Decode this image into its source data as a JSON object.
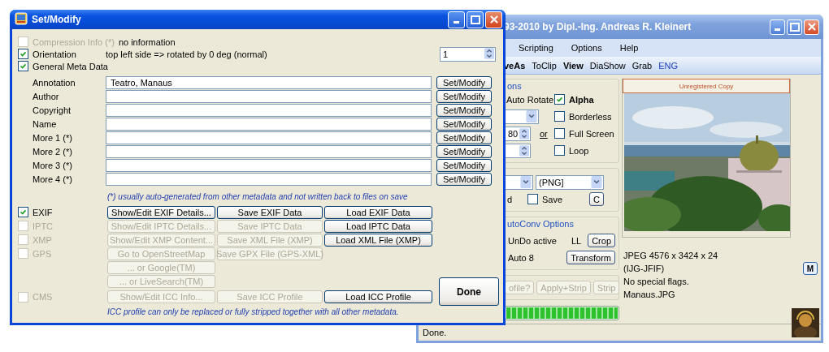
{
  "dialog": {
    "title": "Set/Modify",
    "info_rows": [
      {
        "label": "Compression Info (*)",
        "checked": false,
        "disabled": true,
        "value": "no information"
      },
      {
        "label": "Orientation",
        "checked": true,
        "disabled": false,
        "value": "top left side => rotated by 0 deg (normal)",
        "spinner": "1"
      },
      {
        "label": "General Meta Data",
        "checked": true,
        "disabled": false
      }
    ],
    "fields": [
      {
        "label": "Annotation",
        "value": "Teatro, Manaus",
        "button": "Set/Modify"
      },
      {
        "label": "Author",
        "button": "Set/Modify"
      },
      {
        "label": "Copyright",
        "button": "Set/Modify"
      },
      {
        "label": "Name",
        "button": "Set/Modify"
      },
      {
        "label": "More 1 (*)",
        "button": "Set/Modify"
      },
      {
        "label": "More 2 (*)",
        "button": "Set/Modify"
      },
      {
        "label": "More 3 (*)",
        "button": "Set/Modify"
      },
      {
        "label": "More 4 (*)",
        "button": "Set/Modify"
      }
    ],
    "note": "(*) usually auto-generated from other metadata and not written back to files on save",
    "sections": [
      {
        "label": "EXIF",
        "checked": true,
        "disabled": false,
        "buttons": [
          {
            "label": "Show/Edit EXIF Details...",
            "disabled": false
          },
          {
            "label": "Save EXIF Data",
            "disabled": false
          },
          {
            "label": "Load EXIF Data",
            "disabled": false
          }
        ]
      },
      {
        "label": "IPTC",
        "checked": false,
        "disabled": true,
        "buttons": [
          {
            "label": "Show/Edit IPTC Details...",
            "disabled": true
          },
          {
            "label": "Save IPTC Data",
            "disabled": true
          },
          {
            "label": "Load IPTC Data",
            "disabled": false
          }
        ]
      },
      {
        "label": "XMP",
        "checked": false,
        "disabled": true,
        "buttons": [
          {
            "label": "Show/Edit XMP Content...",
            "disabled": true
          },
          {
            "label": "Save XML File (XMP)",
            "disabled": true
          },
          {
            "label": "Load XML File (XMP)",
            "disabled": false
          }
        ]
      },
      {
        "label": "GPS",
        "checked": false,
        "disabled": true,
        "buttons": [
          {
            "label": "Go to OpenStreetMap",
            "disabled": true
          },
          {
            "label": "Save GPX File (GPS-XML)",
            "disabled": true
          }
        ]
      },
      {
        "buttons": [
          {
            "label": "... or Google(TM)",
            "disabled": true
          }
        ]
      },
      {
        "buttons": [
          {
            "label": "... or LiveSearch(TM)",
            "disabled": true
          }
        ]
      },
      {
        "label": "CMS",
        "checked": false,
        "disabled": true,
        "buttons": [
          {
            "label": "Show/Edit ICC Info...",
            "disabled": true
          },
          {
            "label": "Save ICC Profile",
            "disabled": true
          },
          {
            "label": "Load ICC Profile",
            "disabled": false
          }
        ]
      }
    ],
    "done_button": "Done",
    "footer_note": "ICC profile can only be replaced or fully stripped together with all other metadata."
  },
  "main_window": {
    "title": "93-2010 by Dipl.-Ing. Andreas R. Kleinert",
    "menu": [
      "Scripting",
      "Options",
      "Help"
    ],
    "toolbar": [
      {
        "label": "veAs",
        "kind": "bold"
      },
      {
        "label": "ToClip",
        "kind": "plain"
      },
      {
        "label": "View",
        "kind": "bold"
      },
      {
        "label": "DiaShow",
        "kind": "plain"
      },
      {
        "label": "Grab",
        "kind": "plain"
      },
      {
        "label": "ENG",
        "kind": "link"
      }
    ],
    "view_group": {
      "legend": "ons",
      "auto_rotate": "Auto Rotate",
      "spinner_value": "80",
      "or_link": "or",
      "checkboxes": [
        {
          "label": "Alpha",
          "checked": true
        },
        {
          "label": "Borderless",
          "checked": false
        },
        {
          "label": "Full Screen",
          "checked": false
        },
        {
          "label": "Loop",
          "checked": false
        }
      ]
    },
    "save_group": {
      "format": "(PNG]",
      "label_fragment": "d",
      "save": {
        "label": "Save",
        "checked": false
      },
      "button": "C"
    },
    "autoconv_group": {
      "legend": "utoConv Options",
      "rows": [
        {
          "label": "UnDo active",
          "tag": "LL",
          "button": "Crop"
        },
        {
          "label": "Auto 8",
          "button": "Transform"
        }
      ]
    },
    "strip_buttons": [
      {
        "label": "ofile?",
        "disabled": true
      },
      {
        "label": "Apply+Strip",
        "disabled": true
      },
      {
        "label": "Strip",
        "disabled": true
      }
    ],
    "progress": {
      "level": 1
    },
    "preview": {
      "banner": "Unregistered Copy",
      "info": [
        "JPEG 4576 x 3424 x 24",
        "(IJG-JFIF)",
        "No special flags.",
        "Manaus.JPG"
      ],
      "m_button": "M"
    },
    "status": "Done."
  }
}
